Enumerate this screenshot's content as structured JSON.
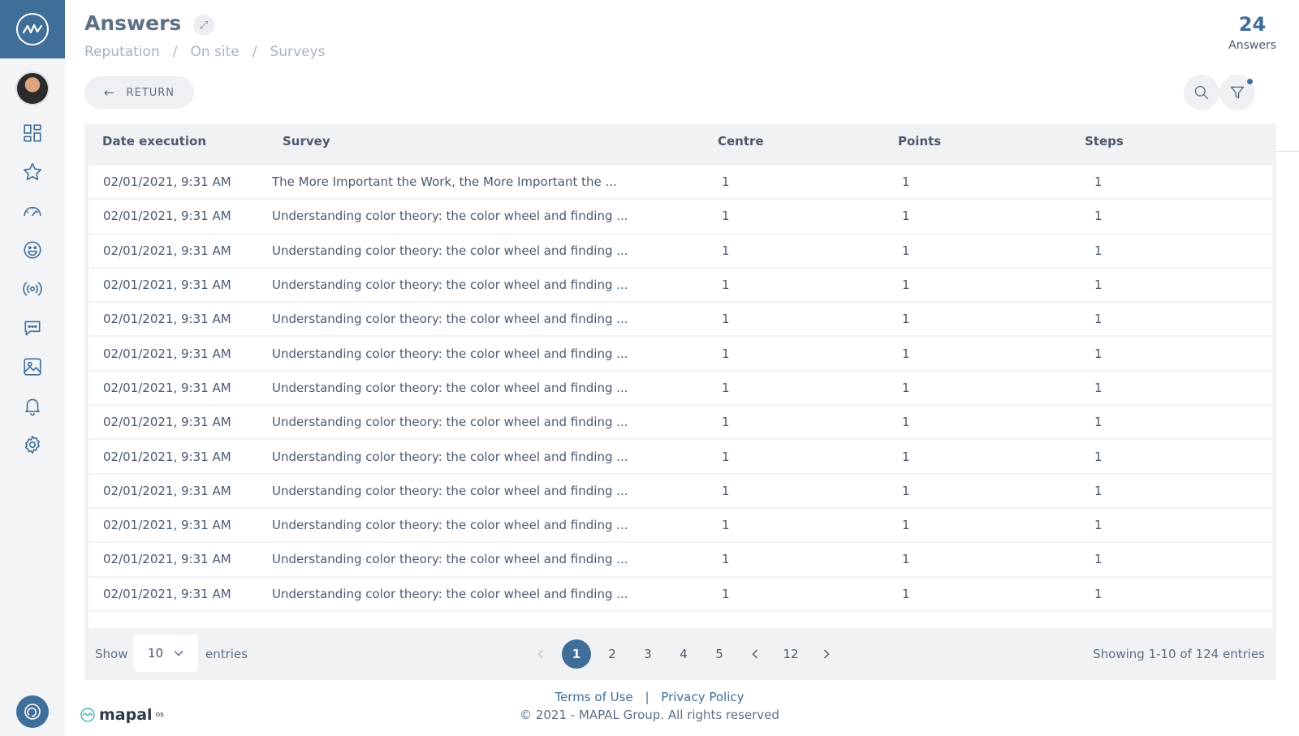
{
  "header": {
    "title": "Answers",
    "breadcrumb": [
      "Reputation",
      "On site",
      "Surveys"
    ],
    "count_value": "24",
    "count_label": "Answers"
  },
  "toolbar": {
    "return_label": "RETURN"
  },
  "table": {
    "columns": [
      "Date execution",
      "Survey",
      "Centre",
      "Points",
      "Steps"
    ],
    "rows": [
      {
        "date": "02/01/2021,  9:31 AM",
        "survey": "The More Important the Work, the More Important the ...",
        "centre": "1",
        "points": "1",
        "steps": "1"
      },
      {
        "date": "02/01/2021,  9:31 AM",
        "survey": "Understanding color theory: the color wheel and finding ...",
        "centre": "1",
        "points": "1",
        "steps": "1"
      },
      {
        "date": "02/01/2021,  9:31 AM",
        "survey": "Understanding color theory: the color wheel and finding ...",
        "centre": "1",
        "points": "1",
        "steps": "1"
      },
      {
        "date": "02/01/2021,  9:31 AM",
        "survey": "Understanding color theory: the color wheel and finding ...",
        "centre": "1",
        "points": "1",
        "steps": "1"
      },
      {
        "date": "02/01/2021,  9:31 AM",
        "survey": "Understanding color theory: the color wheel and finding ...",
        "centre": "1",
        "points": "1",
        "steps": "1"
      },
      {
        "date": "02/01/2021,  9:31 AM",
        "survey": "Understanding color theory: the color wheel and finding ...",
        "centre": "1",
        "points": "1",
        "steps": "1"
      },
      {
        "date": "02/01/2021,  9:31 AM",
        "survey": "Understanding color theory: the color wheel and finding ...",
        "centre": "1",
        "points": "1",
        "steps": "1"
      },
      {
        "date": "02/01/2021,  9:31 AM",
        "survey": "Understanding color theory: the color wheel and finding ...",
        "centre": "1",
        "points": "1",
        "steps": "1"
      },
      {
        "date": "02/01/2021,  9:31 AM",
        "survey": "Understanding color theory: the color wheel and finding ...",
        "centre": "1",
        "points": "1",
        "steps": "1"
      },
      {
        "date": "02/01/2021,  9:31 AM",
        "survey": "Understanding color theory: the color wheel and finding ...",
        "centre": "1",
        "points": "1",
        "steps": "1"
      },
      {
        "date": "02/01/2021,  9:31 AM",
        "survey": "Understanding color theory: the color wheel and finding ...",
        "centre": "1",
        "points": "1",
        "steps": "1"
      },
      {
        "date": "02/01/2021,  9:31 AM",
        "survey": "Understanding color theory: the color wheel and finding ...",
        "centre": "1",
        "points": "1",
        "steps": "1"
      },
      {
        "date": "02/01/2021,  9:31 AM",
        "survey": "Understanding color theory: the color wheel and finding ...",
        "centre": "1",
        "points": "1",
        "steps": "1"
      }
    ]
  },
  "pagination": {
    "show_label": "Show",
    "page_size": "10",
    "entries_label": "entries",
    "pages": [
      "1",
      "2",
      "3",
      "4",
      "5"
    ],
    "last_page": "12",
    "current_page": "1",
    "showing_text": "Showing 1-10 of 124 entries"
  },
  "footer": {
    "terms": "Terms of Use",
    "separator": "|",
    "privacy": "Privacy Policy",
    "copyright": "© 2021 - MAPAL Group. All rights reserved",
    "brand": "mapal",
    "brand_sup": "os"
  },
  "sidebar": {
    "icons": [
      "dashboard-icon",
      "star-icon",
      "speedometer-icon",
      "smiley-icon",
      "broadcast-icon",
      "chat-icon",
      "image-icon",
      "bell-icon",
      "gear-icon"
    ]
  },
  "colors": {
    "accent": "#3f6e99",
    "sidebar_bg": "#f3f4f6",
    "table_bg": "#f1f2f4"
  }
}
